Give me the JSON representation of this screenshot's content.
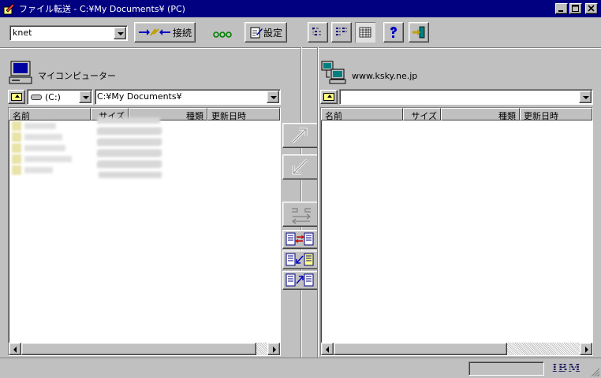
{
  "window": {
    "title": "ファイル転送 - C:¥My Documents¥ (PC)"
  },
  "toolbar": {
    "profile_value": "knet",
    "connect_label": "接続",
    "settings_label": "設定",
    "icons": {
      "connect": "connect-arrows-icon",
      "dots": "status-dots-icon",
      "settings": "edit-settings-icon",
      "view_small": "small-icons-view-icon",
      "view_list": "list-view-icon",
      "view_detail": "detail-view-icon",
      "help": "help-icon",
      "exit": "exit-icon"
    }
  },
  "left_pane": {
    "title": "マイコンピューター",
    "drive_value": "(C:)",
    "path_value": "C:¥My Documents¥",
    "columns": [
      "名前",
      "サイズ",
      "種類",
      "更新日時"
    ],
    "row_count_blurred": 5
  },
  "right_pane": {
    "title": "www.ksky.ne.jp",
    "path_value": "",
    "columns": [
      "名前",
      "サイズ",
      "種類",
      "更新日時"
    ]
  },
  "center": {
    "buttons": [
      "upload-icon",
      "download-icon",
      "sync-icon",
      "compare-left-right-icon",
      "compare-right-to-left-icon",
      "compare-left-to-right-icon"
    ]
  },
  "status": {
    "brand": "IBM"
  },
  "colors": {
    "titlebar": "#000080",
    "face": "#c0c0c0"
  }
}
